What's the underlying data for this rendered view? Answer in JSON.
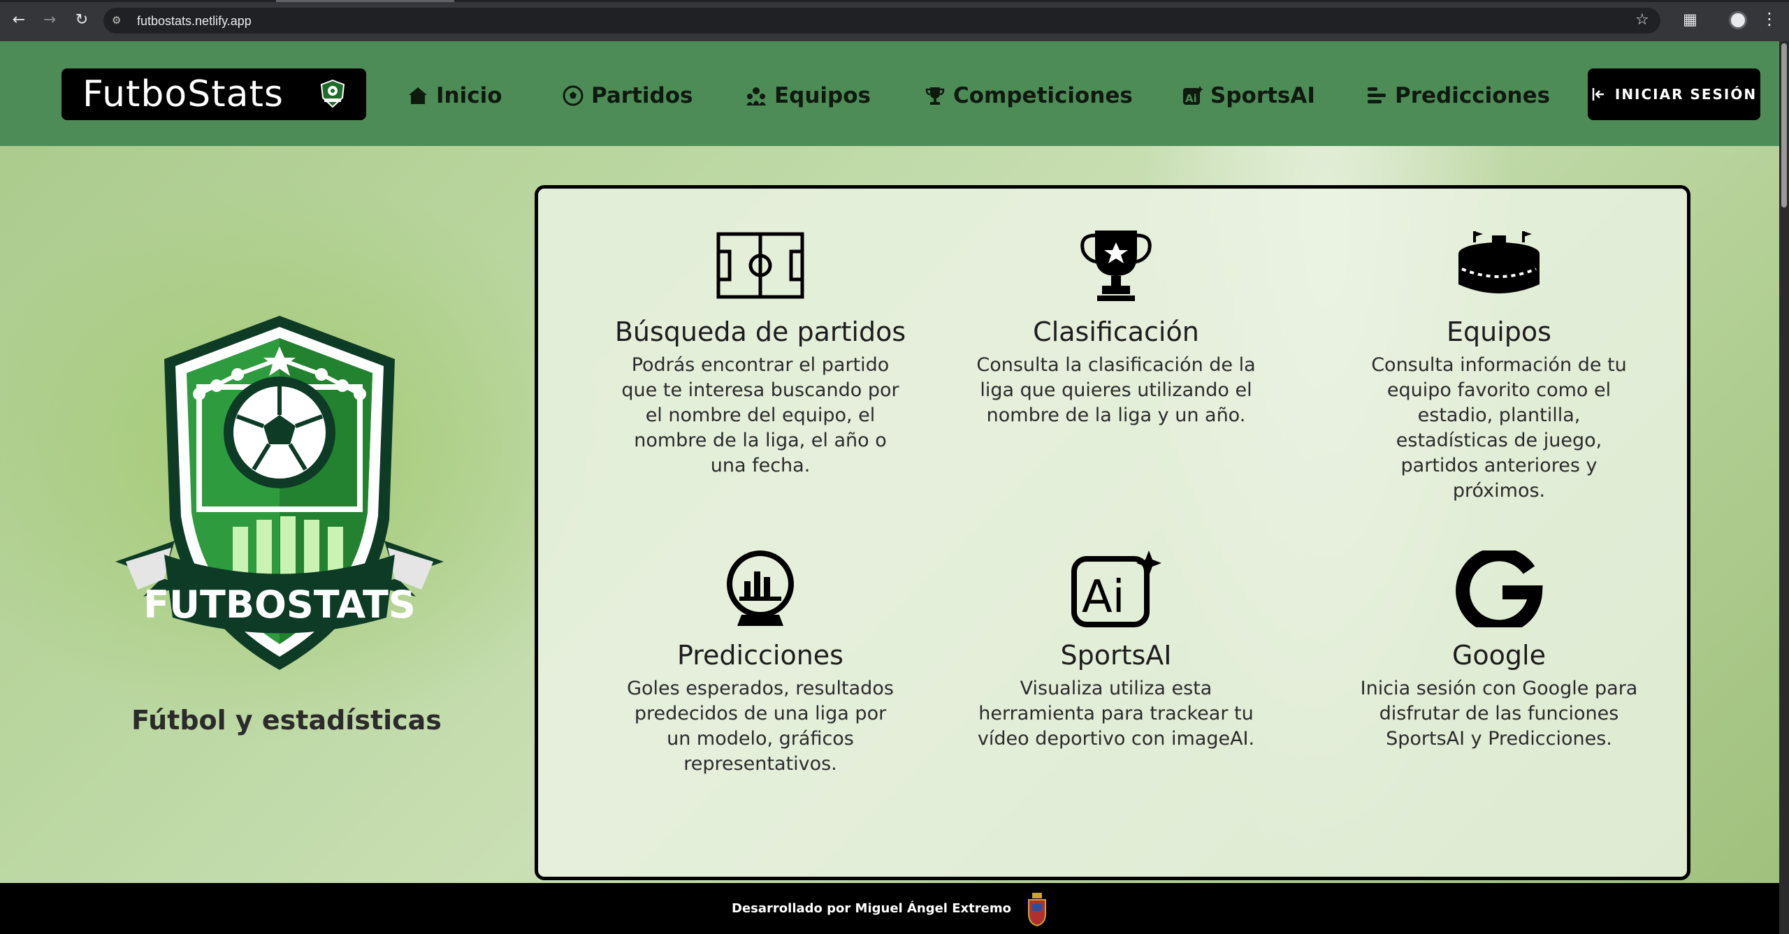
{
  "browser": {
    "url": "futbostats.netlify.app"
  },
  "header": {
    "logo_text": "FutboStats",
    "nav": [
      {
        "label": "Inicio",
        "icon": "home-icon"
      },
      {
        "label": "Partidos",
        "icon": "soccer-ball-icon"
      },
      {
        "label": "Equipos",
        "icon": "team-icon"
      },
      {
        "label": "Competiciones",
        "icon": "trophy-icon"
      },
      {
        "label": "SportsAI",
        "icon": "ai-icon"
      },
      {
        "label": "Predicciones",
        "icon": "bars-icon"
      }
    ],
    "login_label": "INICIAR SESIÓN"
  },
  "hero": {
    "badge_text": "FUTBOSTATS",
    "tagline": "Fútbol y estadísticas"
  },
  "features": [
    {
      "title": "Búsqueda de partidos",
      "desc": "Podrás encontrar el partido que te interesa buscando por el nombre del equipo, el nombre de la liga, el año o una fecha.",
      "icon": "pitch-icon"
    },
    {
      "title": "Clasificación",
      "desc": "Consulta la clasificación de la liga que quieres utilizando el nombre de la liga y un año.",
      "icon": "trophy-icon"
    },
    {
      "title": "Equipos",
      "desc": "Consulta información de tu equipo favorito como el estadio, plantilla, estadísticas de juego, partidos anteriores y próximos.",
      "icon": "stadium-icon"
    },
    {
      "title": "Predicciones",
      "desc": "Goles esperados, resultados predecidos de una liga por un modelo, gráficos representativos.",
      "icon": "crystal-ball-icon"
    },
    {
      "title": "SportsAI",
      "desc": "Visualiza utiliza esta herramienta para trackear tu vídeo deportivo con imageAI.",
      "icon": "ai-icon"
    },
    {
      "title": "Google",
      "desc": "Inicia sesión con Google para disfrutar de las funciones SportsAI y Predicciones.",
      "icon": "google-icon"
    }
  ],
  "footer": {
    "text": "Desarrollado por Miguel Ángel Extremo"
  },
  "colors": {
    "header_green": "#4e8c57",
    "badge_green": "#2e8b3a",
    "black": "#000000"
  }
}
